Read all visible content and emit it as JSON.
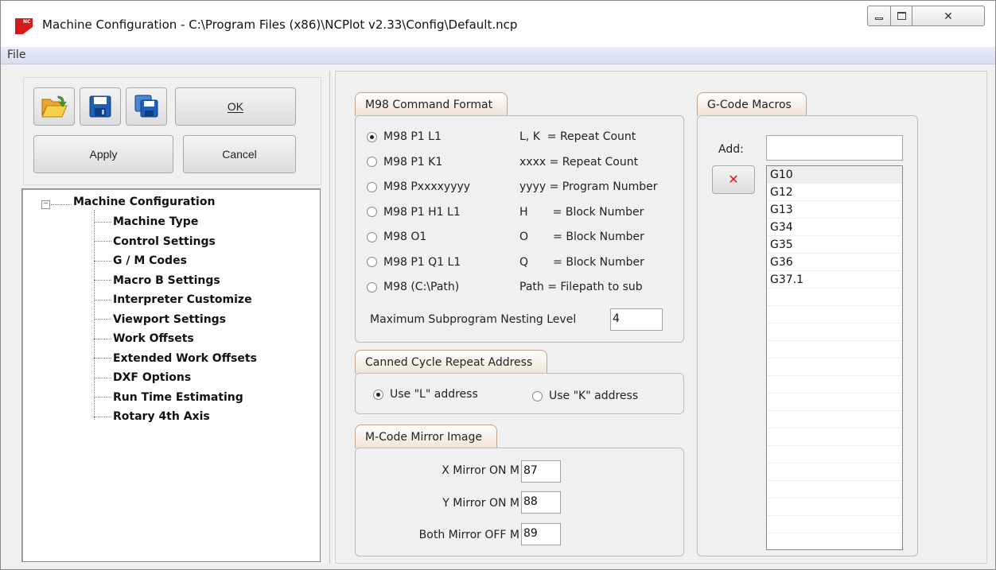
{
  "window": {
    "title": "Machine Configuration - C:\\Program Files (x86)\\NCPlot v2.33\\Config\\Default.ncp",
    "app_icon_text": "NC"
  },
  "menu": {
    "file": "File"
  },
  "toolbar": {
    "ok_label": "OK",
    "apply_label": "Apply",
    "cancel_label": "Cancel"
  },
  "tree": {
    "root": "Machine Configuration",
    "items": [
      "Machine Type",
      "Control Settings",
      "G / M Codes",
      "Macro B Settings",
      "Interpreter Customize",
      "Viewport Settings",
      "Work Offsets",
      "Extended Work Offsets",
      "DXF Options",
      "Run Time Estimating",
      "Rotary 4th Axis"
    ]
  },
  "m98": {
    "title": "M98 Command Format",
    "options": [
      {
        "label": "M98 P1 L1",
        "desc": "L, K  = Repeat Count",
        "checked": true
      },
      {
        "label": "M98 P1 K1",
        "desc": "xxxx = Repeat Count",
        "checked": false
      },
      {
        "label": "M98 Pxxxxyyyy",
        "desc": "yyyy = Program Number",
        "checked": false
      },
      {
        "label": "M98 P1 H1 L1",
        "desc": "H       = Block Number",
        "checked": false
      },
      {
        "label": "M98 O1",
        "desc": "O       = Block Number",
        "checked": false
      },
      {
        "label": "M98 P1 Q1 L1",
        "desc": "Q       = Block Number",
        "checked": false
      },
      {
        "label": "M98 (C:\\Path)",
        "desc": "Path = Filepath to sub",
        "checked": false
      }
    ],
    "nesting_label": "Maximum Subprogram Nesting Level",
    "nesting_value": "4"
  },
  "canned": {
    "title": "Canned Cycle Repeat Address",
    "opt_l": "Use \"L\" address",
    "opt_k": "Use \"K\" address"
  },
  "mirror": {
    "title": "M-Code Mirror Image",
    "x_label": "X Mirror ON  M",
    "x_value": "87",
    "y_label": "Y Mirror ON  M",
    "y_value": "88",
    "both_label": "Both Mirror OFF  M",
    "both_value": "89"
  },
  "macros": {
    "title": "G-Code Macros",
    "add_label": "Add:",
    "add_value": "",
    "delete_glyph": "✕",
    "items": [
      "G10",
      "G12",
      "G13",
      "G34",
      "G35",
      "G36",
      "G37.1"
    ]
  },
  "colors": {
    "accent_red": "#d61a1a",
    "open_folder_yellow": "#f3c02e",
    "floppy_blue": "#1f5fb8"
  }
}
